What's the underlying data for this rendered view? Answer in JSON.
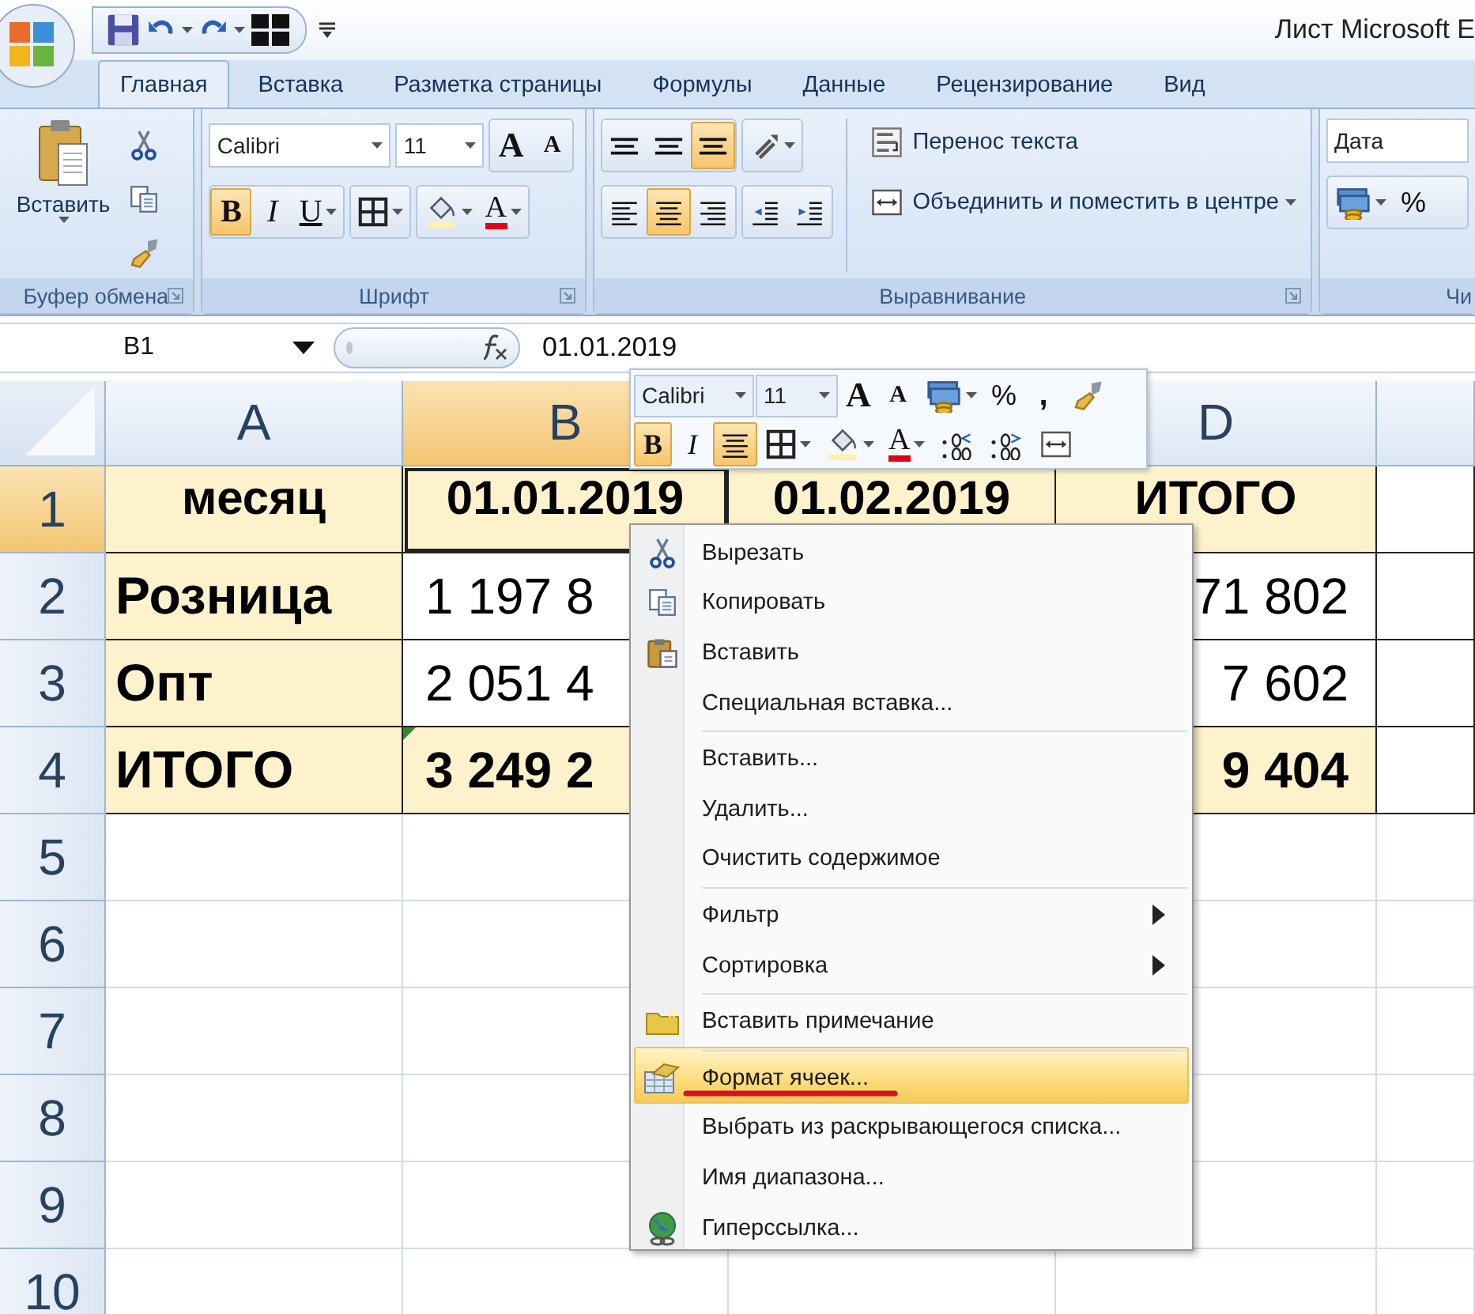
{
  "window": {
    "title": "Лист Microsoft E"
  },
  "tabs": [
    {
      "label": "Главная",
      "selected": true
    },
    {
      "label": "Вставка",
      "selected": false
    },
    {
      "label": "Разметка страницы",
      "selected": false
    },
    {
      "label": "Формулы",
      "selected": false
    },
    {
      "label": "Данные",
      "selected": false
    },
    {
      "label": "Рецензирование",
      "selected": false
    },
    {
      "label": "Вид",
      "selected": false
    }
  ],
  "ribbon": {
    "clipboard": {
      "label": "Буфер обмена",
      "paste_label": "Вставить"
    },
    "font": {
      "label": "Шрифт",
      "font_name": "Calibri",
      "font_size": "11",
      "size_buttons": [
        {
          "kind": "grow",
          "label": "A",
          "selected": false
        },
        {
          "kind": "shrink",
          "label": "A",
          "selected": false
        }
      ],
      "format_buttons": [
        {
          "kind": "bold",
          "label": "B",
          "selected": true,
          "dropdown": false
        },
        {
          "kind": "italic",
          "label": "I",
          "selected": false,
          "dropdown": false
        },
        {
          "kind": "underline",
          "label": "U",
          "selected": false,
          "dropdown": true
        },
        {
          "kind": "borders",
          "selected": false,
          "dropdown": true
        },
        {
          "kind": "fill",
          "selected": false,
          "dropdown": true
        },
        {
          "kind": "font_color",
          "label": "A",
          "selected": false,
          "dropdown": true
        }
      ]
    },
    "alignment": {
      "label": "Выравнивание",
      "vertical_buttons": [
        {
          "kind": "align_top",
          "selected": false,
          "dropdown": false
        },
        {
          "kind": "align_middle",
          "selected": false,
          "dropdown": false
        },
        {
          "kind": "align_bottom",
          "selected": true,
          "dropdown": false
        },
        {
          "kind": "orientation",
          "selected": false,
          "dropdown": true
        }
      ],
      "horizontal_buttons": [
        {
          "kind": "align_left",
          "selected": false,
          "dropdown": false
        },
        {
          "kind": "align_center",
          "selected": true,
          "dropdown": false
        },
        {
          "kind": "align_right",
          "selected": false,
          "dropdown": false
        },
        {
          "kind": "outdent",
          "selected": false,
          "dropdown": false
        },
        {
          "kind": "indent",
          "selected": false,
          "dropdown": false
        }
      ],
      "wrap_text": "Перенос текста",
      "merge": "Объединить и поместить в центре"
    },
    "number": {
      "label": "Чи",
      "format": "Дата",
      "buttons": [
        {
          "kind": "currency",
          "selected": false,
          "dropdown": true
        },
        {
          "kind": "percent",
          "label": "%",
          "selected": false,
          "dropdown": false
        }
      ]
    }
  },
  "formula_bar": {
    "name_box": "B1",
    "value": "01.01.2019"
  },
  "sheet": {
    "columns": [
      {
        "label": "A",
        "selected": false
      },
      {
        "label": "B",
        "selected": true
      },
      null,
      {
        "label": "D",
        "selected": false
      },
      {
        "selected": false
      }
    ],
    "rows": [
      {
        "label": "1",
        "selected": true,
        "cells": [
          {
            "text": "месяц",
            "kind": "heading",
            "bold": true,
            "shaded": true,
            "selected": false
          },
          {
            "text": "01.01.2019",
            "kind": "heading",
            "bold": true,
            "shaded": true,
            "selected": true
          },
          {
            "text": "01.02.2019",
            "kind": "heading",
            "bold": true,
            "shaded": true,
            "selected": false
          },
          {
            "text": "ИТОГО",
            "kind": "heading",
            "bold": true,
            "shaded": true,
            "selected": false
          }
        ]
      },
      {
        "label": "2",
        "selected": false,
        "cells": [
          {
            "text": "Розница",
            "kind": "label",
            "bold": true,
            "shaded": true,
            "selected": false
          },
          {
            "text": "1 197 8",
            "kind": "value",
            "bold": false,
            "shaded": false,
            "selected": false
          },
          null,
          {
            "text": "71 802",
            "kind": "value",
            "bold": false,
            "shaded": false,
            "selected": false
          }
        ]
      },
      {
        "label": "3",
        "selected": false,
        "cells": [
          {
            "text": "Опт",
            "kind": "label",
            "bold": true,
            "shaded": true,
            "selected": false
          },
          {
            "text": "2 051 4",
            "kind": "value",
            "bold": false,
            "shaded": false,
            "selected": false
          },
          null,
          {
            "text": "7 602",
            "kind": "value",
            "bold": false,
            "shaded": false,
            "selected": false
          }
        ]
      },
      {
        "label": "4",
        "selected": false,
        "cells": [
          {
            "text": "ИТОГО",
            "kind": "label",
            "bold": true,
            "shaded": true,
            "selected": false
          },
          {
            "text": "3 249 2",
            "kind": "value",
            "bold": true,
            "shaded": true,
            "selected": false,
            "error_mark": true
          },
          null,
          {
            "text": "9 404",
            "kind": "value",
            "bold": true,
            "shaded": true,
            "selected": false
          }
        ]
      },
      {
        "label": "5",
        "selected": false
      },
      {
        "label": "6",
        "selected": false
      },
      {
        "label": "7",
        "selected": false
      },
      {
        "label": "8",
        "selected": false
      },
      {
        "label": "9",
        "selected": false
      },
      {
        "label": "10",
        "selected": false
      }
    ]
  },
  "mini_toolbar": {
    "font_name": "Calibri",
    "font_size": "11",
    "row_1": [
      {
        "kind": "grow",
        "label": "A",
        "selected": false,
        "dropdown": false
      },
      {
        "kind": "shrink",
        "label": "A",
        "selected": false,
        "dropdown": false
      },
      {
        "kind": "currency",
        "selected": false,
        "dropdown": true
      },
      {
        "kind": "percent",
        "label": "%",
        "selected": false,
        "dropdown": false
      },
      {
        "kind": "comma",
        "label": ",",
        "selected": false,
        "dropdown": false
      },
      {
        "kind": "painter",
        "selected": false,
        "dropdown": false
      }
    ],
    "row_2": [
      {
        "kind": "bold",
        "label": "B",
        "selected": true,
        "dropdown": false
      },
      {
        "kind": "italic",
        "label": "I",
        "selected": false,
        "dropdown": false
      },
      {
        "kind": "align_center",
        "selected": true,
        "dropdown": false
      },
      {
        "kind": "borders",
        "selected": false,
        "dropdown": true
      },
      {
        "kind": "fill",
        "selected": false,
        "dropdown": true
      },
      {
        "kind": "font_color",
        "label": "A",
        "selected": false,
        "dropdown": true
      },
      {
        "kind": "inc_decimal",
        "selected": false,
        "dropdown": false
      },
      {
        "kind": "dec_decimal",
        "selected": false,
        "dropdown": false
      },
      {
        "kind": "merge",
        "selected": false,
        "dropdown": false
      }
    ]
  },
  "context_menu": {
    "items": [
      {
        "label": "Вырезать",
        "selected": false,
        "separator_before": false
      },
      {
        "label": "Копировать",
        "selected": false,
        "separator_before": false
      },
      {
        "label": "Вставить",
        "selected": false,
        "separator_before": false
      },
      {
        "label": "Специальная вставка...",
        "selected": false,
        "separator_before": false
      },
      {
        "label": "Вставить...",
        "selected": false,
        "separator_before": true
      },
      {
        "label": "Удалить...",
        "selected": false,
        "separator_before": false
      },
      {
        "label": "Очистить содержимое",
        "selected": false,
        "separator_before": false
      },
      {
        "label": "Фильтр",
        "selected": false,
        "separator_before": true,
        "submenu": true
      },
      {
        "label": "Сортировка",
        "selected": false,
        "separator_before": false,
        "submenu": true
      },
      {
        "label": "Вставить примечание",
        "selected": false,
        "separator_before": true
      },
      {
        "label": "Формат ячеек...",
        "selected": true,
        "separator_before": true,
        "marked": true
      },
      {
        "label": "Выбрать из раскрывающегося списка...",
        "selected": false,
        "separator_before": false
      },
      {
        "label": "Имя диапазона...",
        "selected": false,
        "separator_before": false
      },
      {
        "label": "Гиперссылка...",
        "selected": false,
        "separator_before": false
      }
    ]
  }
}
